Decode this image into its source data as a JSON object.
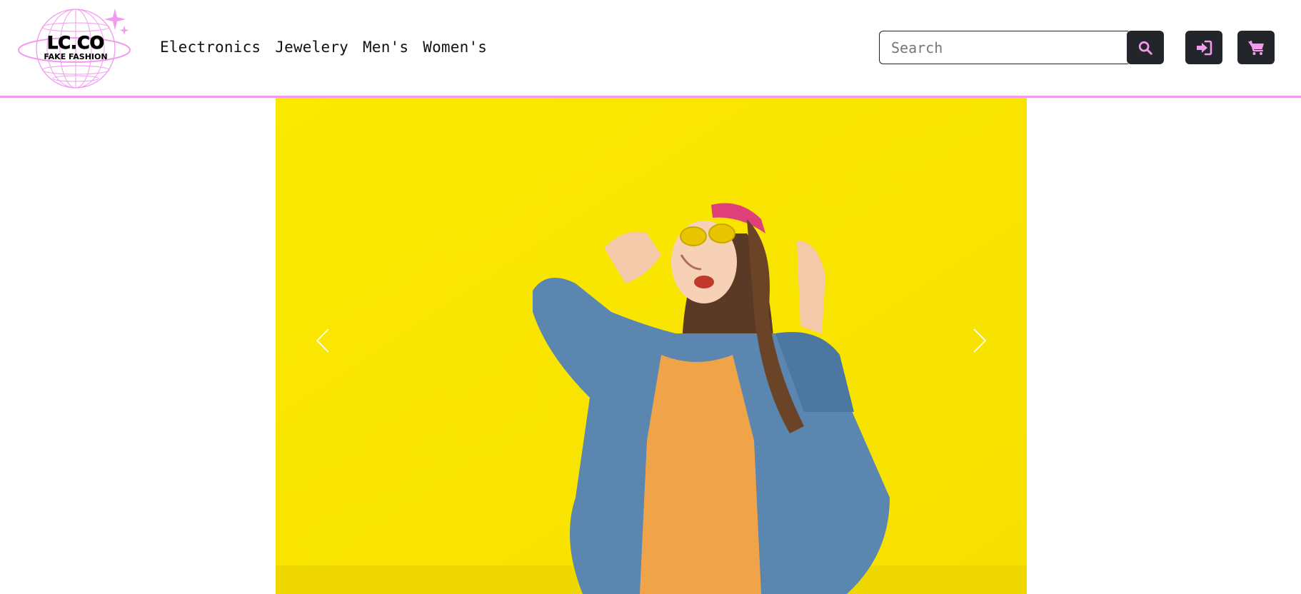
{
  "brand": {
    "logo_text": "LC.CO",
    "logo_subtext": "FAKE FASHION",
    "accent_color": "#f29bed"
  },
  "nav": {
    "links": [
      {
        "label": "Electronics"
      },
      {
        "label": "Jewelery"
      },
      {
        "label": "Men's"
      },
      {
        "label": "Women's"
      }
    ]
  },
  "search": {
    "placeholder": "Search",
    "value": "",
    "icon": "search-icon"
  },
  "actions": {
    "login_icon": "sign-in-icon",
    "cart_icon": "shopping-cart-icon"
  },
  "carousel": {
    "prev_icon": "chevron-left-icon",
    "next_icon": "chevron-right-icon",
    "background_color": "#fbe900"
  }
}
